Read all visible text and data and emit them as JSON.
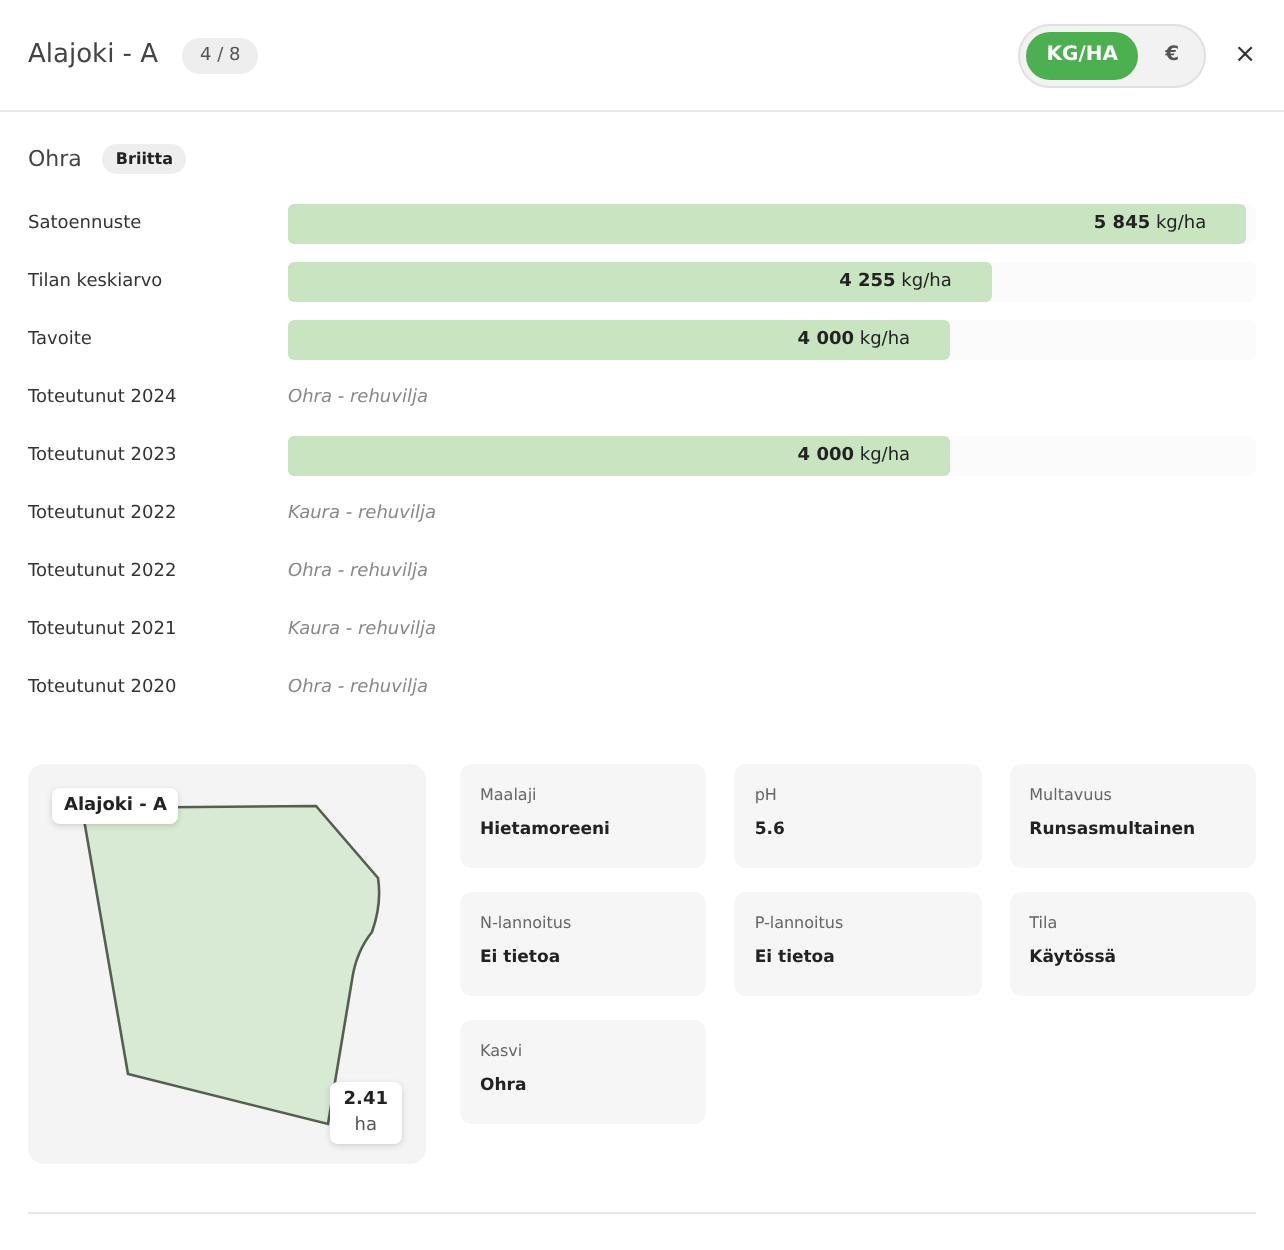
{
  "header": {
    "title": "Alajoki - A",
    "counter": "4 / 8",
    "units": [
      {
        "label": "KG/HA",
        "selected": true
      },
      {
        "label": "€",
        "selected": false
      }
    ],
    "close": "×"
  },
  "crop": {
    "name": "Ohra",
    "variety": "Briitta"
  },
  "rows": [
    {
      "label": "Satoennuste",
      "kind": "bar",
      "level": 0.99,
      "value": "5 845",
      "unit": "kg/ha"
    },
    {
      "label": "Tilan keskiarvo",
      "kind": "bar",
      "level": 0.727,
      "value": "4 255",
      "unit": "kg/ha"
    },
    {
      "label": "Tavoite",
      "kind": "bar",
      "level": 0.684,
      "value": "4 000",
      "unit": "kg/ha"
    },
    {
      "label": "Toteutunut 2024",
      "kind": "text",
      "text": "Ohra - rehuvilja"
    },
    {
      "label": "Toteutunut 2023",
      "kind": "bar",
      "level": 0.684,
      "value": "4 000",
      "unit": "kg/ha"
    },
    {
      "label": "Toteutunut 2022",
      "kind": "text",
      "text": "Kaura - rehuvilja"
    },
    {
      "label": "Toteutunut 2022",
      "kind": "text",
      "text": "Ohra - rehuvilja"
    },
    {
      "label": "Toteutunut 2021",
      "kind": "text",
      "text": "Kaura - rehuvilja"
    },
    {
      "label": "Toteutunut 2020",
      "kind": "text",
      "text": "Ohra - rehuvilja"
    }
  ],
  "map": {
    "label": "Alajoki - A",
    "area": "2.41",
    "area_unit": "ha"
  },
  "details": [
    {
      "label": "Maalaji",
      "value": "Hietamoreeni"
    },
    {
      "label": "pH",
      "value": "5.6"
    },
    {
      "label": "Multavuus",
      "value": "Runsasmultainen"
    },
    {
      "label": "N-lannoitus",
      "value": "Ei tietoa"
    },
    {
      "label": "P-lannoitus",
      "value": "Ei tietoa"
    },
    {
      "label": "Tila",
      "value": "Käytössä"
    },
    {
      "label": "Kasvi",
      "value": "Ohra"
    }
  ]
}
